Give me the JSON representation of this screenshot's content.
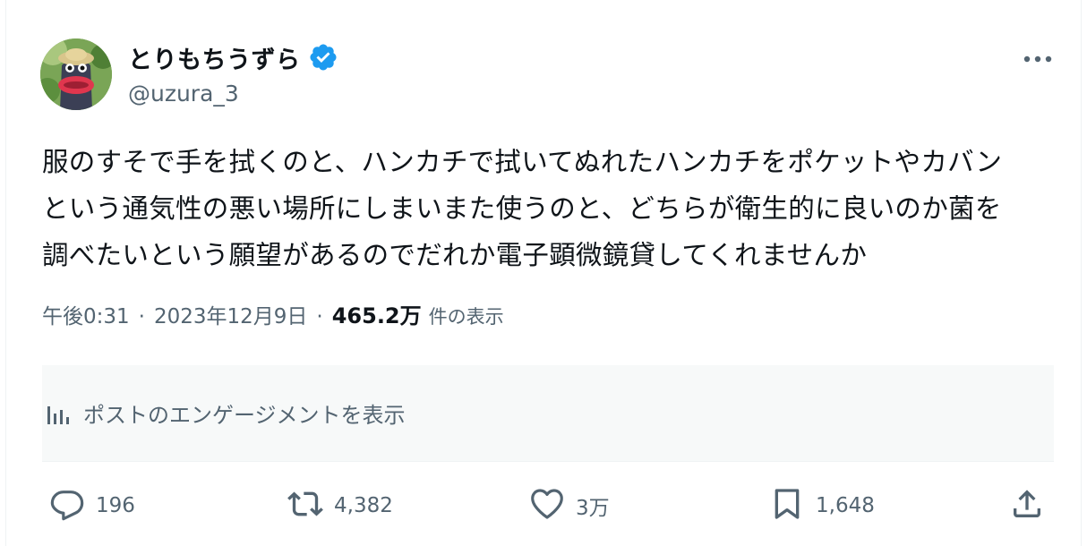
{
  "user": {
    "display_name": "とりもちうずら",
    "handle": "@uzura_3",
    "verified": true,
    "verified_color": "#1d9bf0",
    "avatar_icon": "avatar"
  },
  "tweet": {
    "text_lines": [
      "服のすそで手を拭くのと、ハンカチで拭いてぬれたハンカチをポケットやカバン",
      "という通気性の悪い場所にしまいまた使うのと、どちらが衛生的に良いのか菌を",
      "調べたいという願望があるのでだれか電子顕微鏡貸してくれませんか"
    ],
    "time": "午後0:31",
    "separator": "·",
    "date": "2023年12月9日",
    "views": "465.2万",
    "views_label": "件の表示"
  },
  "engagement_link": {
    "icon": "analytics-icon",
    "label": "ポストのエンゲージメントを表示"
  },
  "actions": {
    "reply": {
      "icon": "reply-icon",
      "count": "196"
    },
    "retweet": {
      "icon": "retweet-icon",
      "count": "4,382"
    },
    "like": {
      "icon": "heart-icon",
      "count": "3万"
    },
    "bookmark": {
      "icon": "bookmark-icon",
      "count": "1,648"
    },
    "share": {
      "icon": "share-icon"
    }
  },
  "colors": {
    "text_primary": "#0f1419",
    "text_secondary": "#536471",
    "engagement_bg": "#f7f9f9"
  }
}
